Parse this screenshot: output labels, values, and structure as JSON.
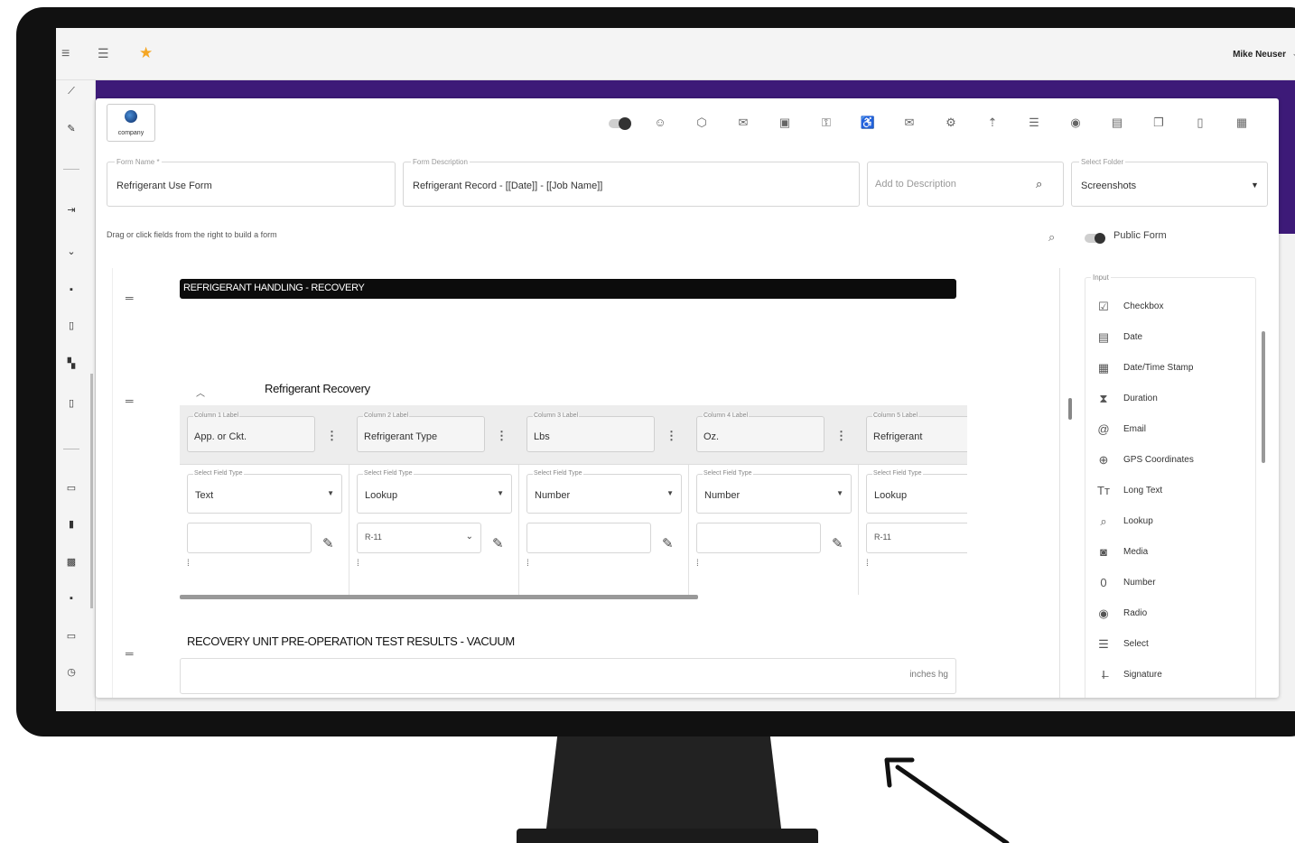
{
  "topbar": {
    "user_name": "Mike Neuser"
  },
  "logo": {
    "label": "company"
  },
  "form": {
    "name": {
      "label": "Form Name *",
      "value": "Refrigerant Use Form"
    },
    "description": {
      "label": "Form Description",
      "value": "Refrigerant Record - [[Date]] - [[Job Name]]"
    },
    "add_description": {
      "placeholder": "Add to Description"
    },
    "folder": {
      "label": "Select Folder",
      "value": "Screenshots"
    }
  },
  "builder": {
    "hint": "Drag or click fields from the right to build a form",
    "public_form_label": "Public Form",
    "section1_title": "REFRIGERANT HANDLING - RECOVERY",
    "group_title": "Refrigerant Recovery",
    "columns": [
      {
        "label": "Column 1 Label",
        "value": "App. or Ckt.",
        "type_label": "Select Field Type",
        "type": "Text",
        "extra": ""
      },
      {
        "label": "Column 2 Label",
        "value": "Refrigerant Type",
        "type_label": "Select Field Type",
        "type": "Lookup",
        "extra": "R-11"
      },
      {
        "label": "Column 3 Label",
        "value": "Lbs",
        "type_label": "Select Field Type",
        "type": "Number",
        "extra": ""
      },
      {
        "label": "Column 4 Label",
        "value": "Oz.",
        "type_label": "Select Field Type",
        "type": "Number",
        "extra": ""
      },
      {
        "label": "Column 5 Label",
        "value": "Refrigerant",
        "type_label": "Select Field Type",
        "type": "Lookup",
        "extra": "R-11"
      }
    ],
    "section2_title": "RECOVERY UNIT PRE-OPERATION TEST RESULTS - VACUUM",
    "unit": "inches hg"
  },
  "palette": {
    "label": "Input",
    "items": [
      {
        "icon": "checkbox-icon",
        "label": "Checkbox"
      },
      {
        "icon": "date-icon",
        "label": "Date"
      },
      {
        "icon": "datetime-icon",
        "label": "Date/Time Stamp"
      },
      {
        "icon": "hourglass-icon",
        "label": "Duration"
      },
      {
        "icon": "at-icon",
        "label": "Email"
      },
      {
        "icon": "gps-icon",
        "label": "GPS Coordinates"
      },
      {
        "icon": "text-icon",
        "label": "Long Text"
      },
      {
        "icon": "search-icon",
        "label": "Lookup"
      },
      {
        "icon": "camera-icon",
        "label": "Media"
      },
      {
        "icon": "zero-icon",
        "label": "Number"
      },
      {
        "icon": "radio-icon",
        "label": "Radio"
      },
      {
        "icon": "list-icon",
        "label": "Select"
      },
      {
        "icon": "signature-icon",
        "label": "Signature"
      }
    ]
  },
  "colors": {
    "brand_purple": "#3d1a78",
    "accent_star": "#f5a623",
    "section_bar": "#0c0c0c"
  }
}
